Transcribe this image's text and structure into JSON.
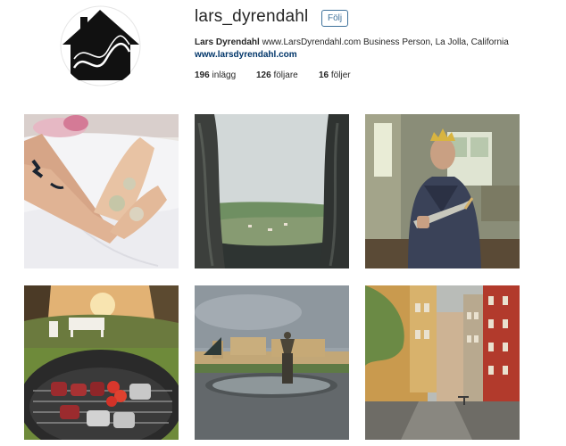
{
  "profile": {
    "username": "lars_dyrendahl",
    "follow_label": "Följ",
    "full_name": "Lars Dyrendahl",
    "bio": "www.LarsDyrendahl.com Business Person, La Jolla, California",
    "website": "www.larsdyrendahl.com"
  },
  "stats": {
    "posts_count": "196",
    "posts_label": "inlägg",
    "followers_count": "126",
    "followers_label": "följare",
    "following_count": "16",
    "following_label": "följer"
  },
  "posts": [
    {
      "subject": "feet-on-bed-photo"
    },
    {
      "subject": "foggy-valley-view-photo"
    },
    {
      "subject": "man-with-crown-and-sword-photo"
    },
    {
      "subject": "sunset-garden-photo"
    },
    {
      "subject": "palace-fountain-photo"
    },
    {
      "subject": "narrow-alley-photo"
    }
  ]
}
